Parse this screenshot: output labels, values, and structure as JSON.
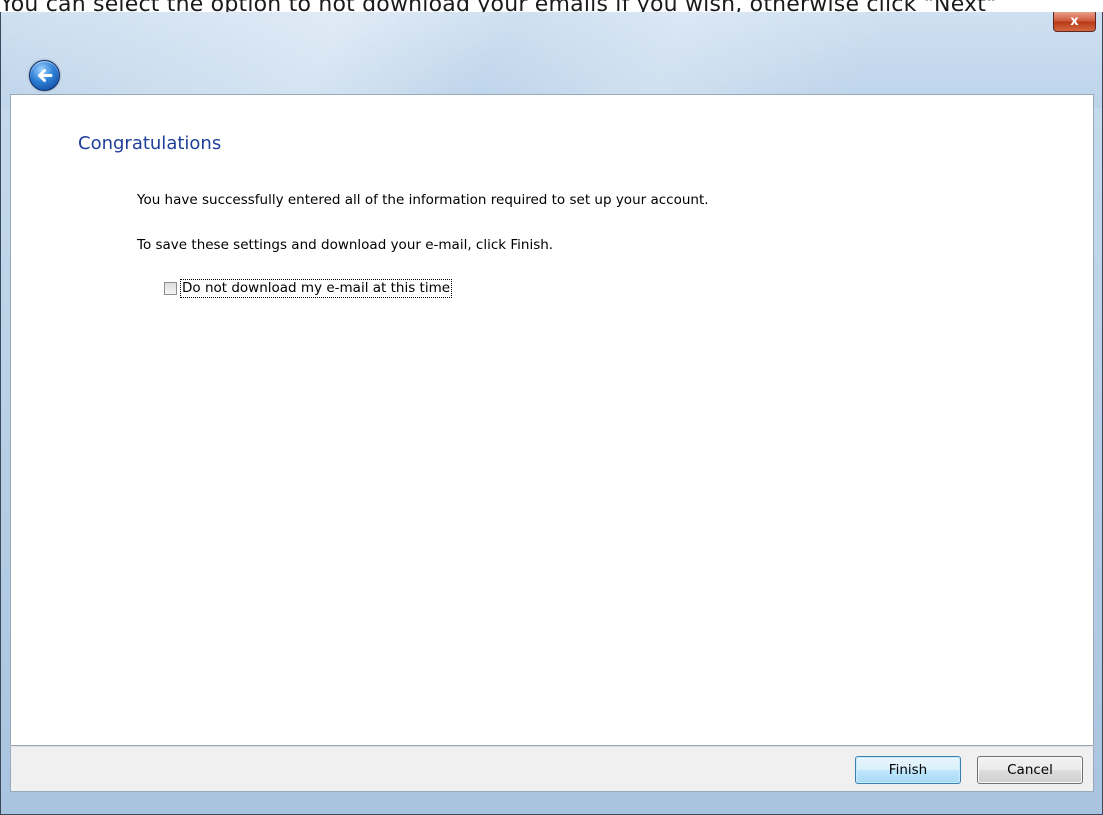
{
  "caption": "You can select the option to not download your emails if you wish, otherwise click \"Next\"",
  "titlebar": {
    "close_label": "x",
    "close_icon": "close-icon",
    "back_icon": "back-arrow-icon"
  },
  "wizard": {
    "heading": "Congratulations",
    "message_success": "You have successfully entered all of the information required to set up your account.",
    "message_instruction": "To save these settings and download your e-mail, click Finish.",
    "checkbox_label": "Do not download my e-mail at this time",
    "checkbox_checked": false
  },
  "footer": {
    "finish_label": "Finish",
    "cancel_label": "Cancel"
  },
  "colors": {
    "heading": "#1e3f9a",
    "close_button": "#c84a2a",
    "default_button_border": "#3c7fb1"
  }
}
